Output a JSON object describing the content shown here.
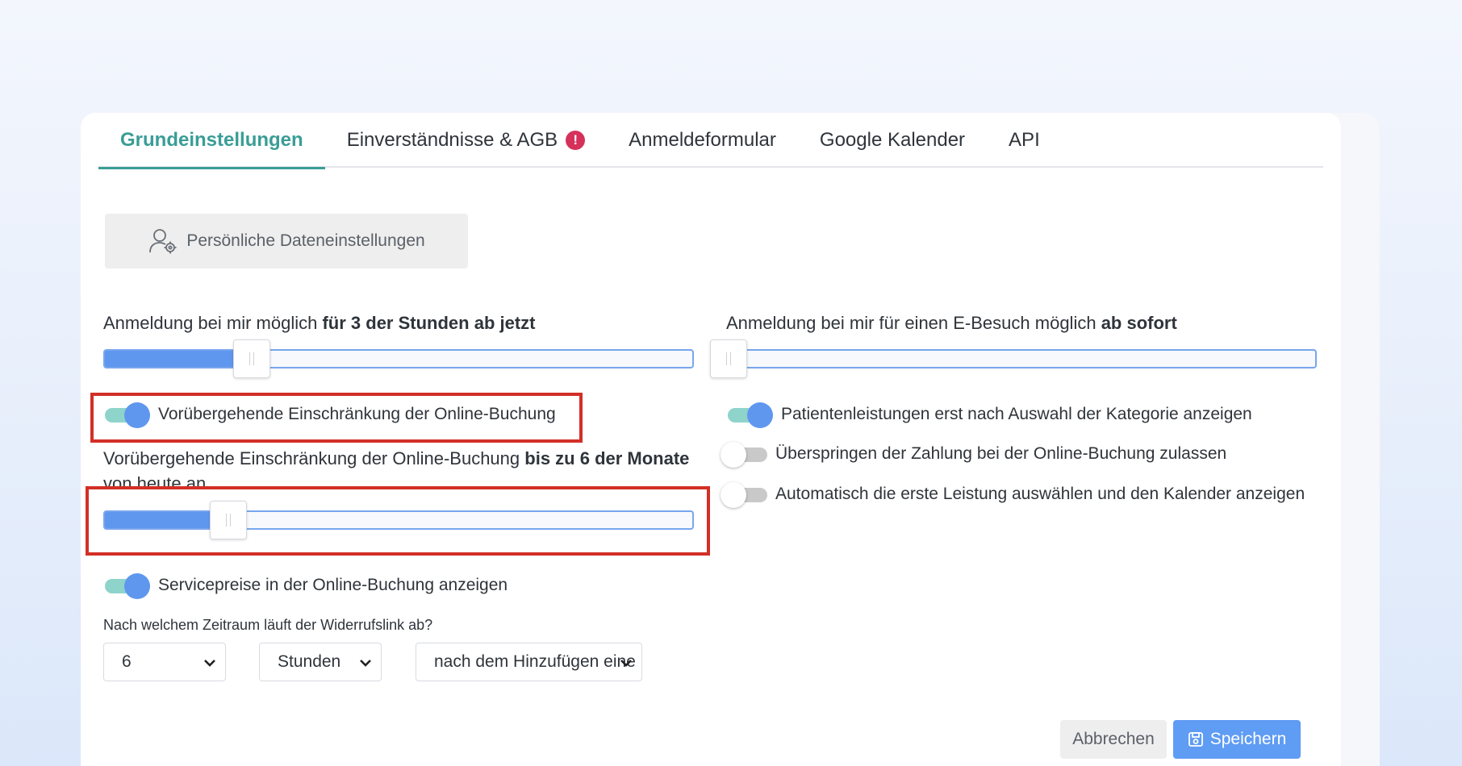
{
  "tabs": [
    {
      "label": "Grundeinstellungen",
      "active": true
    },
    {
      "label": "Einverständnisse & AGB",
      "alert": "!"
    },
    {
      "label": "Anmeldeformular"
    },
    {
      "label": "Google Kalender"
    },
    {
      "label": "API"
    }
  ],
  "personal_button": {
    "label": "Persönliche Dateneinstellungen",
    "icon": "user-settings-icon"
  },
  "booking_window": {
    "prefix": "Anmeldung bei mir möglich ",
    "bold": "für 3 der Stunden ab jetzt",
    "slider_fraction": 0.25
  },
  "ebesuch_window": {
    "prefix": "Anmeldung bei mir für einen E-Besuch möglich ",
    "bold": "ab sofort",
    "slider_fraction": 0.0
  },
  "toggles_left": [
    {
      "label": "Vorübergehende Einschränkung der Online-Buchung",
      "on": true
    }
  ],
  "restriction": {
    "prefix": "Vorübergehende Einschränkung der Online-Buchung ",
    "bold": "bis zu 6 der Monate",
    "suffix": "von heute an",
    "slider_fraction": 0.21
  },
  "service_prices_toggle": {
    "label": "Servicepreise in der Online-Buchung anzeigen",
    "on": true
  },
  "toggles_right": [
    {
      "label": "Patientenleistungen erst nach Auswahl der Kategorie anzeigen",
      "on": true
    },
    {
      "label": "Überspringen der Zahlung bei der Online-Buchung zulassen",
      "on": false
    },
    {
      "label": "Automatisch die erste Leistung auswählen und den Kalender anzeigen",
      "on": false
    }
  ],
  "revocation": {
    "question": "Nach welchem Zeitraum läuft der Widerrufslink ab?",
    "amount": "6",
    "unit": "Stunden",
    "reference": "nach dem Hinzufügen eine"
  },
  "footer": {
    "cancel_label": "Abbrechen",
    "save_label": "Speichern",
    "save_icon": "save-icon"
  },
  "colors": {
    "accent_teal": "#3a9d96",
    "primary_blue": "#5f97ef",
    "alert_red": "#d6315b",
    "highlight_red": "#d22f27"
  }
}
